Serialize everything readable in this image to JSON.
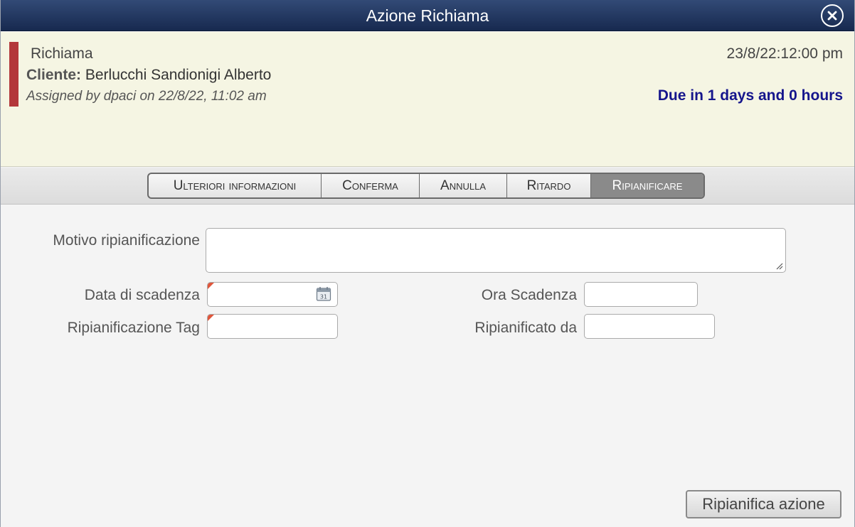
{
  "dialog": {
    "title": "Azione Richiama",
    "close_icon": "close-circle-icon"
  },
  "info": {
    "type": "Richiama",
    "client_label": "Cliente:",
    "client_name": "Berlucchi Sandionigi Alberto",
    "assigned": "Assigned by dpaci on 22/8/22, 11:02 am",
    "datetime": "23/8/22:12:00 pm",
    "due": "Due in 1 days and 0 hours",
    "colors": {
      "priority_bar": "#b3373a",
      "due_text": "#15158c",
      "panel_bg": "#f5f5e3"
    }
  },
  "tabs": [
    {
      "label": "Ulteriori informazioni",
      "active": false
    },
    {
      "label": "Conferma",
      "active": false
    },
    {
      "label": "Annulla",
      "active": false
    },
    {
      "label": "Ritardo",
      "active": false
    },
    {
      "label": "Ripianificare",
      "active": true
    }
  ],
  "form": {
    "reason_label": "Motivo ripianificazione",
    "reason_value": "",
    "due_date_label": "Data di scadenza",
    "due_date_value": "",
    "due_date_icon": "calendar-icon",
    "due_time_label": "Ora Scadenza",
    "due_time_value": "",
    "tag_label": "Ripianificazione Tag",
    "tag_value": "",
    "rescheduled_by_label": "Ripianificato da",
    "rescheduled_by_value": "",
    "submit_label": "Ripianifica azione"
  }
}
